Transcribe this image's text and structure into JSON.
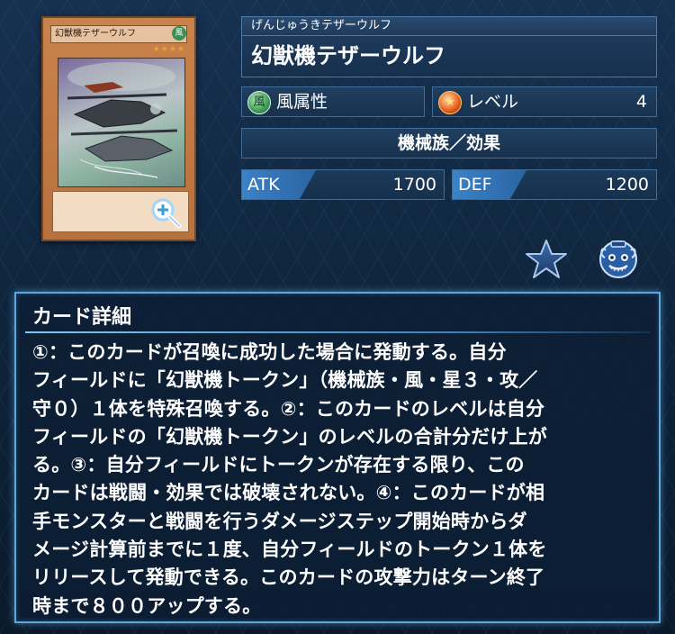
{
  "card_image": {
    "name": "幻獣機テザーウルフ",
    "attribute_glyph": "風",
    "stars": "★★★★",
    "zoom_icon": "zoom-in-icon"
  },
  "card": {
    "kana": "げんじゅうきテザーウルフ",
    "name": "幻獣機テザーウルフ",
    "attribute": {
      "glyph": "風",
      "label": "風属性",
      "color": "#3e9a56"
    },
    "level": {
      "label": "レベル",
      "value": "4",
      "color": "#e55b1b"
    },
    "race": "機械族／効果",
    "atk": {
      "label": "ATK",
      "value": "1700"
    },
    "def": {
      "label": "DEF",
      "value": "1200"
    }
  },
  "actions": {
    "favorite_icon": "star-icon",
    "deck_icon": "pot-icon"
  },
  "detail": {
    "title": "カード詳細",
    "text": "①：このカードが召喚に成功した場合に発動する。自分\nフィールドに「幻獣機トークン」（機械族・風・星３・攻／\n守０）１体を特殊召喚する。②：このカードのレベルは自分\nフィールドの「幻獣機トークン」のレベルの合計分だけ上が\nる。③：自分フィールドにトークンが存在する限り、この\nカードは戦闘・効果では破壊されない。④：このカードが相\n手モンスターと戦闘を行うダメージステップ開始時からダ\nメージ計算前までに１度、自分フィールドのトークン１体を\nリリースして発動できる。このカードの攻撃力はターン終了\n時まで８００アップする。"
  }
}
